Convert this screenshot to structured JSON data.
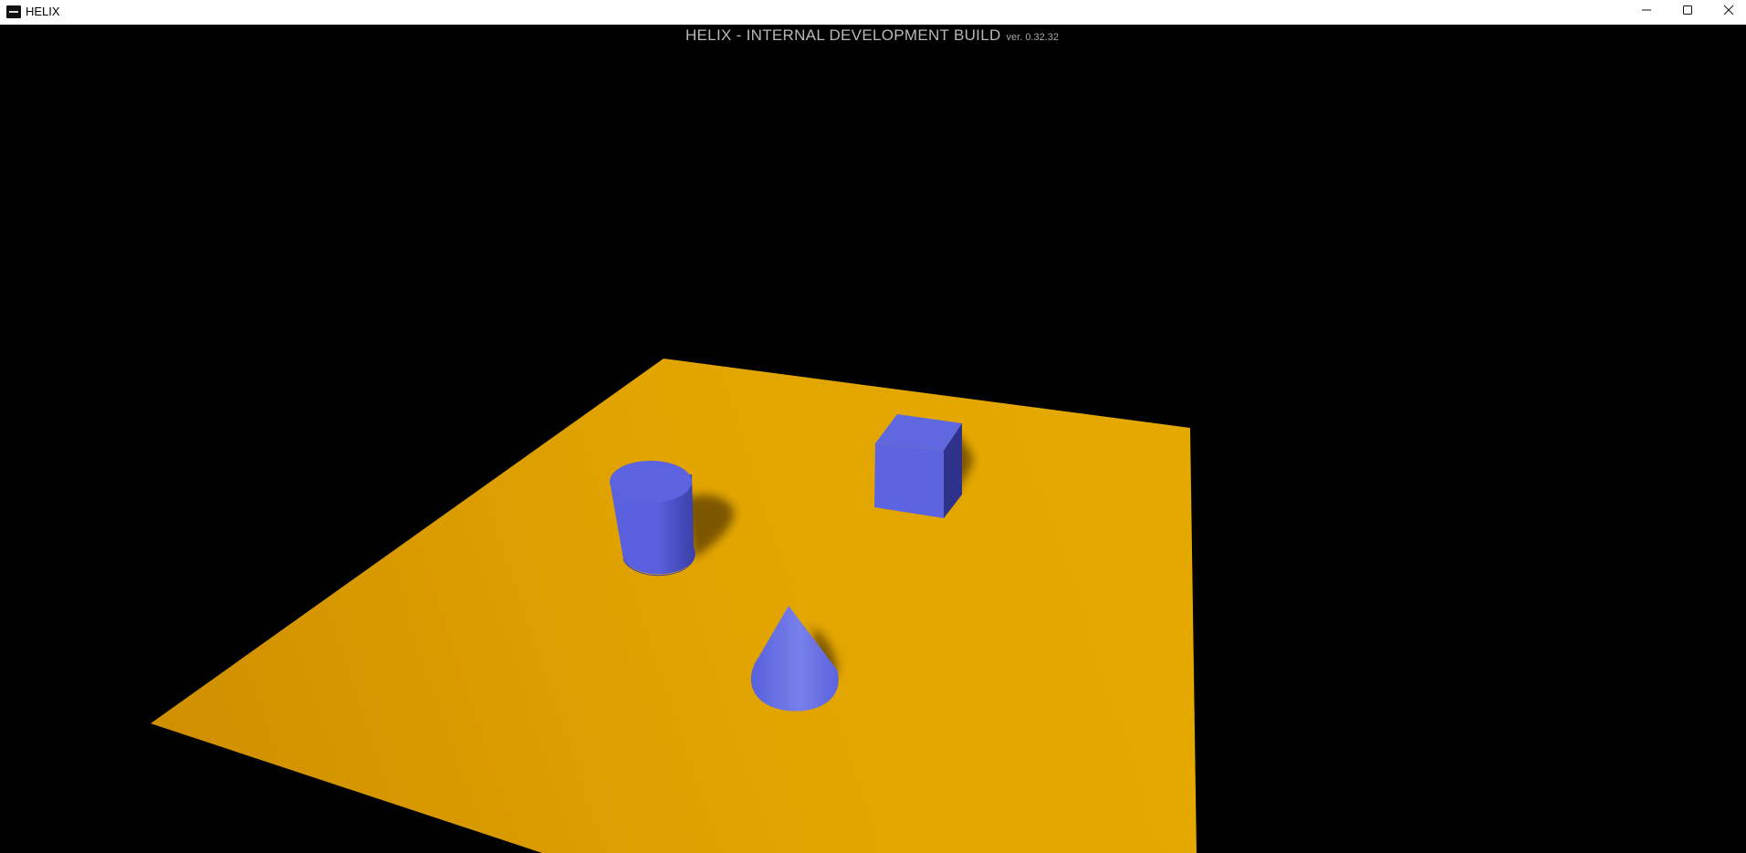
{
  "window": {
    "title": "HELIX",
    "controls": {
      "minimize_icon": "minimize-icon",
      "maximize_icon": "maximize-icon",
      "close_icon": "close-icon"
    }
  },
  "viewport": {
    "build_title": "HELIX - INTERNAL DEVELOPMENT BUILD",
    "build_version": "ver. 0.32.32"
  },
  "scene": {
    "objects": [
      "ground-plane",
      "cylinder",
      "cube",
      "cone"
    ],
    "colors": {
      "background": "#000000",
      "ground": "#e2a500",
      "primitive": "#5b63df"
    }
  }
}
